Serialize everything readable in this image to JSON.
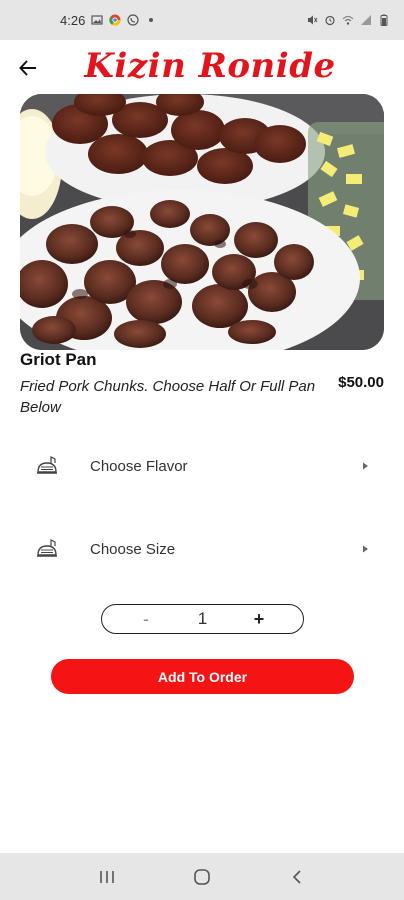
{
  "status_bar": {
    "time": "4:26",
    "left_icons": [
      "image-icon",
      "chrome-icon",
      "whatsapp-icon",
      "dot-icon"
    ],
    "right_icons": [
      "mute-icon",
      "alarm-icon",
      "wifi-icon",
      "signal-icon",
      "battery-icon"
    ]
  },
  "header": {
    "brand": "Kizin Ronide",
    "back_icon": "arrow-left-icon"
  },
  "product": {
    "name": "Griot Pan",
    "description": "Fried Pork Chunks. Choose Half Or Full Pan Below",
    "price": "$50.00"
  },
  "options": [
    {
      "label": "Choose Flavor",
      "icon": "food-tray-icon"
    },
    {
      "label": "Choose Size",
      "icon": "food-tray-icon"
    }
  ],
  "quantity": {
    "minus": "-",
    "value": "1",
    "plus": "+"
  },
  "add_button": {
    "label": "Add To Order"
  },
  "colors": {
    "accent": "#f41414",
    "brand": "#e3141b",
    "system_bar": "#e6e6e6"
  },
  "nav_bar": {
    "buttons": [
      "recent-apps-icon",
      "home-icon",
      "back-icon"
    ]
  }
}
